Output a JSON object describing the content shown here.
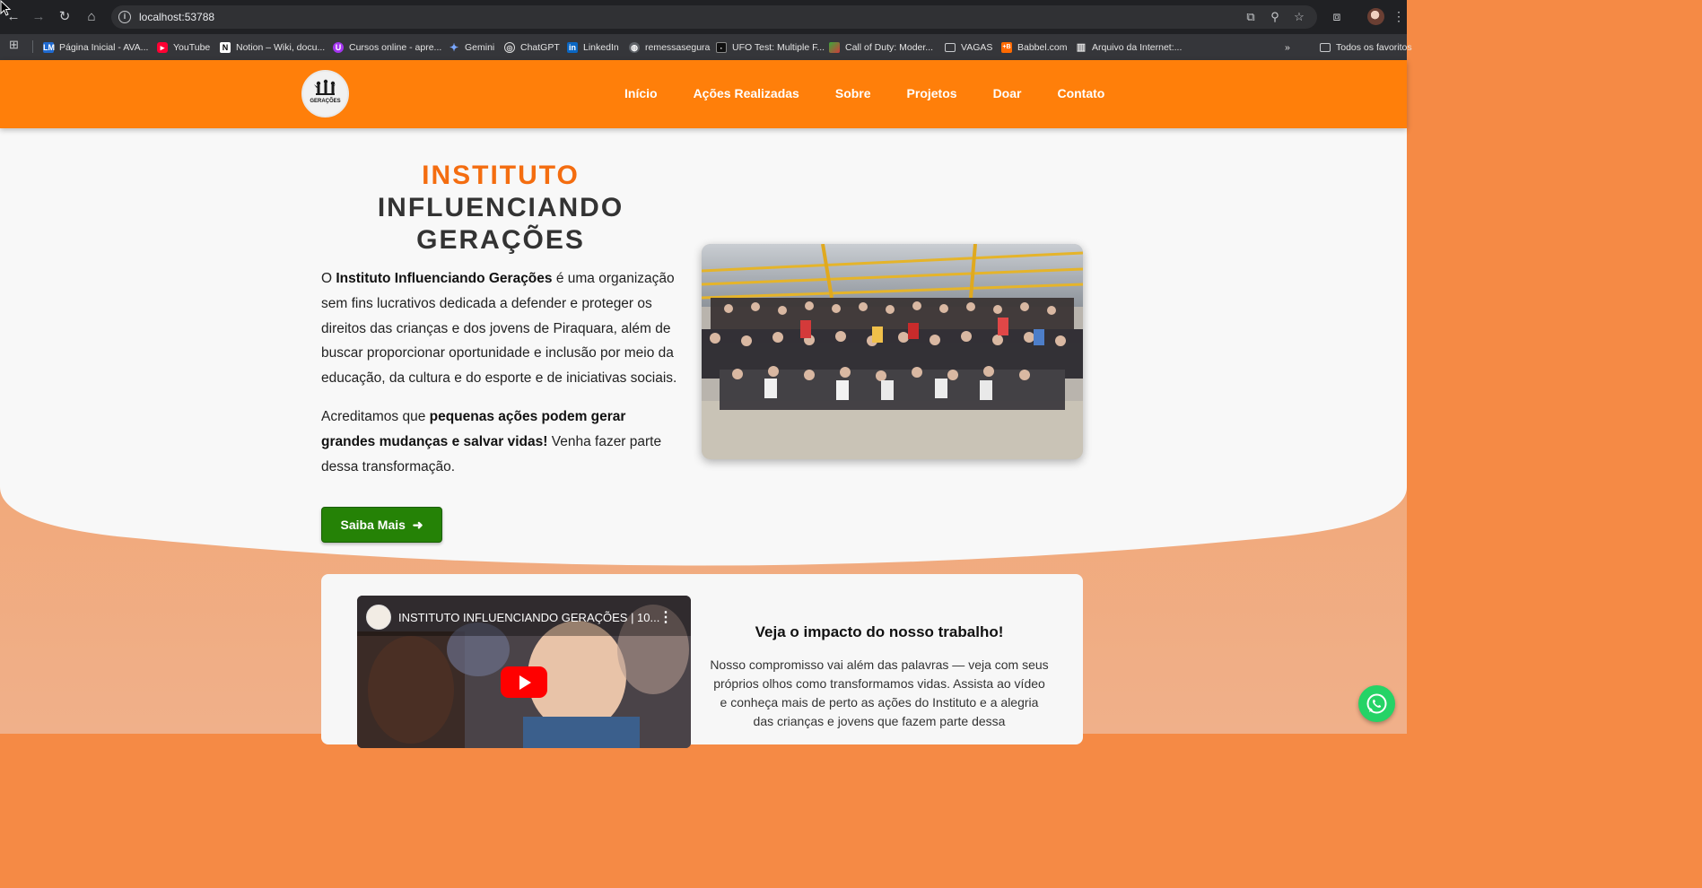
{
  "browser": {
    "url": "localhost:53788",
    "bookmarks": [
      {
        "label": "Página Inicial - AVA...",
        "icon": "ava-icon"
      },
      {
        "label": "YouTube",
        "icon": "youtube-icon"
      },
      {
        "label": "Notion – Wiki, docu...",
        "icon": "notion-icon"
      },
      {
        "label": "Cursos online - apre...",
        "icon": "udemy-icon"
      },
      {
        "label": "Gemini",
        "icon": "gemini-icon"
      },
      {
        "label": "ChatGPT",
        "icon": "chatgpt-icon"
      },
      {
        "label": "LinkedIn",
        "icon": "linkedin-icon"
      },
      {
        "label": "remessasegura",
        "icon": "globe-icon"
      },
      {
        "label": "UFO Test: Multiple F...",
        "icon": "ufo-icon"
      },
      {
        "label": "Call of Duty: Moder...",
        "icon": "cod-icon"
      },
      {
        "label": "VAGAS",
        "icon": "folder-icon"
      },
      {
        "label": "Babbel.com",
        "icon": "babbel-icon"
      },
      {
        "label": "Arquivo da Internet:...",
        "icon": "archive-icon"
      }
    ],
    "all_bookmarks_label": "Todos os favoritos"
  },
  "site": {
    "logo_text": "GERAÇÕES",
    "nav": [
      "Início",
      "Ações Realizadas",
      "Sobre",
      "Projetos",
      "Doar",
      "Contato"
    ],
    "hero": {
      "title_line1": "INSTITUTO",
      "title_line2": "INFLUENCIANDO",
      "title_line3": "GERAÇÕES",
      "p1_pre": "O ",
      "p1_bold": "Instituto Influenciando Gerações",
      "p1_post": " é uma organização sem fins lucrativos dedicada a defender e proteger os direitos das crianças e dos jovens de Piraquara, além de buscar proporcionar oportunidade e inclusão por meio da educação, da cultura e do esporte e de iniciativas sociais.",
      "p2_pre": "Acreditamos que ",
      "p2_bold": "pequenas ações podem gerar grandes mudanças e salvar vidas!",
      "p2_post": " Venha fazer parte dessa transformação.",
      "cta": "Saiba Mais"
    },
    "video": {
      "title": "INSTITUTO INFLUENCIANDO GERAÇÕES | 10...",
      "heading": "Veja o impacto do nosso trabalho!",
      "text": "Nosso compromisso vai além das palavras — veja com seus próprios olhos como transformamos vidas. Assista ao vídeo e conheça mais de perto as ações do Instituto e a alegria das crianças e jovens que fazem parte dessa"
    }
  },
  "colors": {
    "header_orange": "#ff7f0a",
    "title_orange": "#f46d10",
    "cta_green": "#258206",
    "whatsapp": "#25d366"
  }
}
